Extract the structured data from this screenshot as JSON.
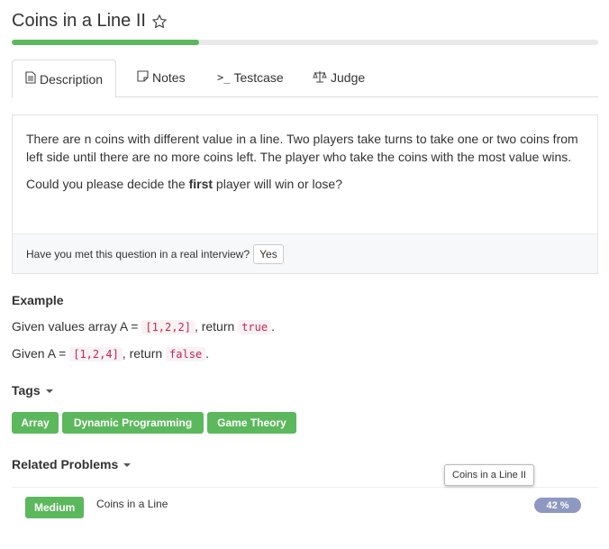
{
  "problem": {
    "title": "Coins in a Line II",
    "progress_fraction": 0.32
  },
  "tabs": [
    {
      "label": "Description",
      "icon": "document-icon"
    },
    {
      "label": "Notes",
      "icon": "note-icon"
    },
    {
      "label": "Testcase",
      "icon": "terminal-icon"
    },
    {
      "label": "Judge",
      "icon": "scale-icon"
    }
  ],
  "description": {
    "paragraph1": "There are n coins with different value in a line. Two players take turns to take one or two coins from left side until there are no more coins left. The player who take the coins with the most value wins.",
    "question_prefix": "Could you please decide the ",
    "question_bold": "first",
    "question_suffix": " player will win or lose?"
  },
  "interview": {
    "question": "Have you met this question in a real interview?",
    "yes_label": "Yes"
  },
  "example": {
    "heading": "Example",
    "line1_prefix": "Given values array A = ",
    "line1_array": "[1,2,2]",
    "line1_middle": ", return ",
    "line1_result": "true",
    "line1_suffix": ".",
    "line2_prefix": "Given A = ",
    "line2_array": "[1,2,4]",
    "line2_middle": ", return ",
    "line2_result": "false",
    "line2_suffix": "."
  },
  "tags": {
    "heading": "Tags",
    "items": [
      "Array",
      "Dynamic Programming",
      "Game Theory"
    ]
  },
  "related": {
    "heading": "Related Problems",
    "items": [
      {
        "difficulty": "Medium",
        "title": "Coins in a Line",
        "rate": "42 %"
      }
    ],
    "tooltip": "Coins in a Line II"
  },
  "colors": {
    "accent_green": "#5cb85c",
    "rate_badge": "#8e98c1",
    "code_text": "#c7254e"
  }
}
